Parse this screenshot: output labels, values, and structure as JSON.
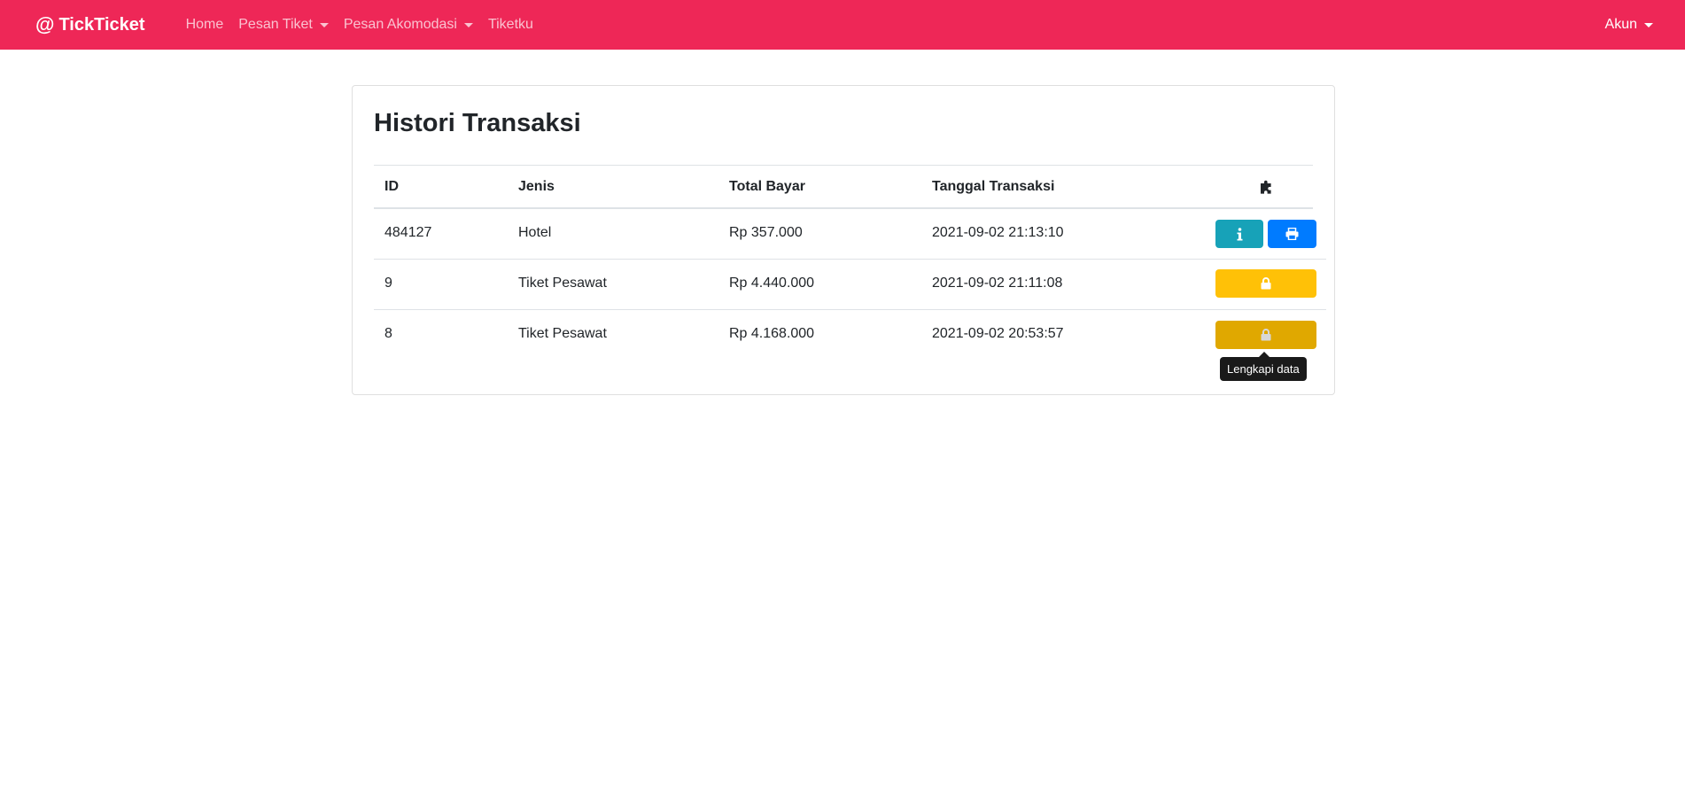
{
  "navbar": {
    "brand_symbol": "@",
    "brand_name": "TickTicket",
    "links": [
      {
        "label": "Home",
        "dropdown": false
      },
      {
        "label": "Pesan Tiket",
        "dropdown": true
      },
      {
        "label": "Pesan Akomodasi",
        "dropdown": true
      },
      {
        "label": "Tiketku",
        "dropdown": false
      }
    ],
    "account_label": "Akun",
    "background_color": "#ee2757"
  },
  "page": {
    "title": "Histori Transaksi"
  },
  "table": {
    "headers": {
      "id": "ID",
      "jenis": "Jenis",
      "total": "Total Bayar",
      "tanggal": "Tanggal Transaksi",
      "action_icon": "puzzle-piece-icon"
    },
    "rows": [
      {
        "id": "484127",
        "jenis": "Hotel",
        "total": "Rp 357.000",
        "tanggal": "2021-09-02 21:13:10",
        "actions": [
          "info",
          "print"
        ]
      },
      {
        "id": "9",
        "jenis": "Tiket Pesawat",
        "total": "Rp 4.440.000",
        "tanggal": "2021-09-02 21:11:08",
        "actions": [
          "lock"
        ]
      },
      {
        "id": "8",
        "jenis": "Tiket Pesawat",
        "total": "Rp 4.168.000",
        "tanggal": "2021-09-02 20:53:57",
        "actions": [
          "lock"
        ]
      }
    ]
  },
  "tooltip": {
    "text": "Lengkapi data"
  },
  "colors": {
    "info": "#17a2b8",
    "primary": "#007bff",
    "warning": "#ffc107",
    "warning_hover": "#e0a800"
  }
}
